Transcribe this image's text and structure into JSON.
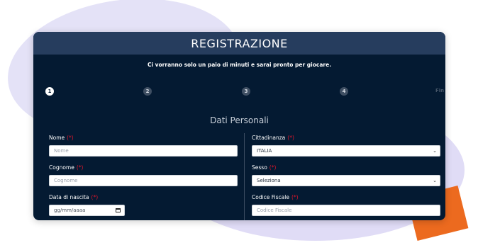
{
  "header": {
    "title": "REGISTRAZIONE"
  },
  "subtitle": "Ci vorranno solo un paio di minuti e sarai pronto per giocare.",
  "steps": [
    "1",
    "2",
    "3",
    "4",
    "Fin"
  ],
  "section": {
    "title": "Dati Personali"
  },
  "required_mark": "(*)",
  "form": {
    "nome": {
      "label": "Nome",
      "placeholder": "Nome"
    },
    "cognome": {
      "label": "Cognome",
      "placeholder": "Cognome"
    },
    "data_nascita": {
      "label": "Data di nascita",
      "placeholder": "gg/mm/aaaa"
    },
    "cittadinanza": {
      "label": "Cittadinanza",
      "value": "ITALIA"
    },
    "sesso": {
      "label": "Sesso",
      "value": "Seleziona"
    },
    "codice_fiscale": {
      "label": "Codice Fiscale",
      "placeholder": "Codice Fiscale"
    }
  },
  "colors": {
    "modal_bg": "#041a32",
    "header_bg": "#263d5e",
    "required": "#e2162b",
    "accent_orange": "#ec6a1f"
  },
  "icons": {
    "select_arrow": "chevron-down-icon",
    "date_picker": "calendar-icon"
  }
}
